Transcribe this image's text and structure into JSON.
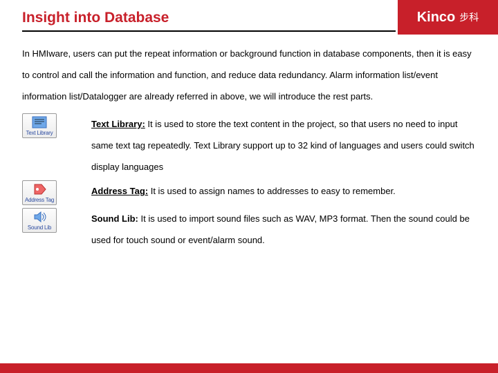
{
  "logo": {
    "brand": "Kinco",
    "cn": "步科"
  },
  "title": "Insight into Database",
  "intro": "In HMIware, users can put the repeat information or background function in database components, then it is easy to control and call the information and function, and reduce data redundancy. Alarm information list/event information list/Datalogger are already referred in above, we will introduce the rest parts.",
  "items": [
    {
      "icon_label": "Text Library",
      "lead": "Text Library:",
      "lead_underline": true,
      "body": " It is used to store the text content in the project, so that users no need to input same text tag repeatedly. Text Library support up to 32 kind of languages and users could switch display languages"
    },
    {
      "icon_label": "Address Tag",
      "lead": "Address Tag:",
      "lead_underline": true,
      "body": " It is used to assign names to addresses to easy to remember."
    },
    {
      "icon_label": "Sound Lib",
      "lead": "Sound Lib:",
      "lead_underline": false,
      "body": "  It is used to import sound files such as WAV, MP3 format. Then the sound could be used for touch sound or event/alarm sound."
    }
  ]
}
